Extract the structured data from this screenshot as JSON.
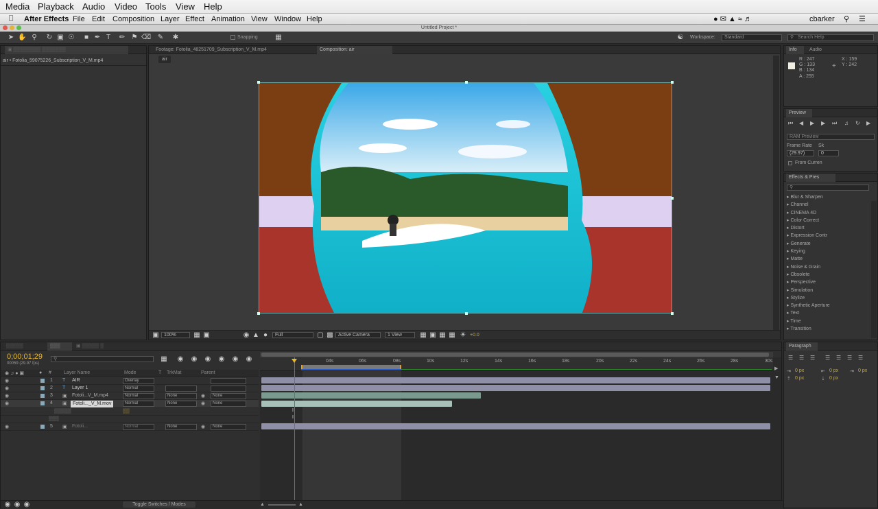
{
  "system_menu": [
    "Media",
    "Playback",
    "Audio",
    "Video",
    "Tools",
    "View",
    "Help"
  ],
  "system_user": "cbarker",
  "app_menu": [
    "After Effects",
    "File",
    "Edit",
    "Composition",
    "Layer",
    "Effect",
    "Animation",
    "View",
    "Window",
    "Help"
  ],
  "window_title": "Untitled Project *",
  "toolbar": {
    "snapping_label": "Snapping",
    "workspace_label": "Workspace:",
    "workspace_value": "Standard",
    "search_placeholder": "Search Help"
  },
  "project_panel": {
    "item": "air • Fotolia_59075226_Subscription_V_M.mp4"
  },
  "viewer": {
    "tabs": [
      "Footage: Fotolia_48251709_Subscription_V_M.mp4",
      "Composition: air"
    ],
    "comp_tab": "air",
    "zoom": "100%",
    "resolution": "Full",
    "camera": "Active Camera",
    "views": "1 View",
    "exposure": "+0.0"
  },
  "info_panel": {
    "tabs": [
      "Info",
      "Audio"
    ],
    "r": "R : 247",
    "g": "G : 133",
    "b": "B : 134",
    "a": "A : 255",
    "x": "X : 159",
    "y": "Y : 242"
  },
  "preview_panel": {
    "tab": "Preview",
    "ram_preview": "RAM Preview",
    "frame_rate_label": "Frame Rate",
    "frame_rate": "(29.97)",
    "skip_label": "Sk",
    "skip_value": "0",
    "from_current": "From Curren"
  },
  "effects_panel": {
    "tab": "Effects & Pres",
    "categories": [
      "Blur & Sharpen",
      "Channel",
      "CINEMA 4D",
      "Color Correct",
      "Distort",
      "Expression Contr",
      "Generate",
      "Keying",
      "Matte",
      "Noise & Grain",
      "Obsolete",
      "Perspective",
      "Simulation",
      "Stylize",
      "Synthetic Aperture",
      "Text",
      "Time",
      "Transition"
    ]
  },
  "paragraph_panel": {
    "tab": "Paragraph",
    "values": [
      "0 px",
      "0 px",
      "0 px",
      "0 px",
      "0 px"
    ]
  },
  "timeline": {
    "timecode": "0;00;01;29",
    "frame_info": "00059 (29.97 fps)",
    "columns": {
      "layer_name": "Layer Name",
      "mode": "Mode",
      "t": "T",
      "trkmat": "TrkMat",
      "parent": "Parent"
    },
    "ruler": [
      "04s",
      "06s",
      "08s",
      "10s",
      "12s",
      "14s",
      "16s",
      "18s",
      "20s",
      "22s",
      "24s",
      "26s",
      "28s",
      "30s"
    ],
    "layers": [
      {
        "num": "1",
        "name": "AIR",
        "mode": "Overlay",
        "trkmat": "",
        "parent": ""
      },
      {
        "num": "2",
        "name": "Layer 1",
        "mode": "Normal",
        "trkmat": "",
        "parent": ""
      },
      {
        "num": "3",
        "name": "Fotoli...V_M.mp4",
        "mode": "Normal",
        "trkmat": "None",
        "parent": "None"
      },
      {
        "num": "4",
        "name": "Fotoli..._V_M.mov",
        "mode": "Normal",
        "trkmat": "None",
        "parent": "None"
      },
      {
        "num": "5",
        "name": "Fotoli...",
        "mode": "Normal",
        "trkmat": "None",
        "parent": "None"
      }
    ],
    "toggle_label": "Toggle Switches / Modes"
  },
  "colors": {
    "accent": "#e8c24a",
    "timecode": "#e8b830",
    "playhead": "#d9443c"
  }
}
